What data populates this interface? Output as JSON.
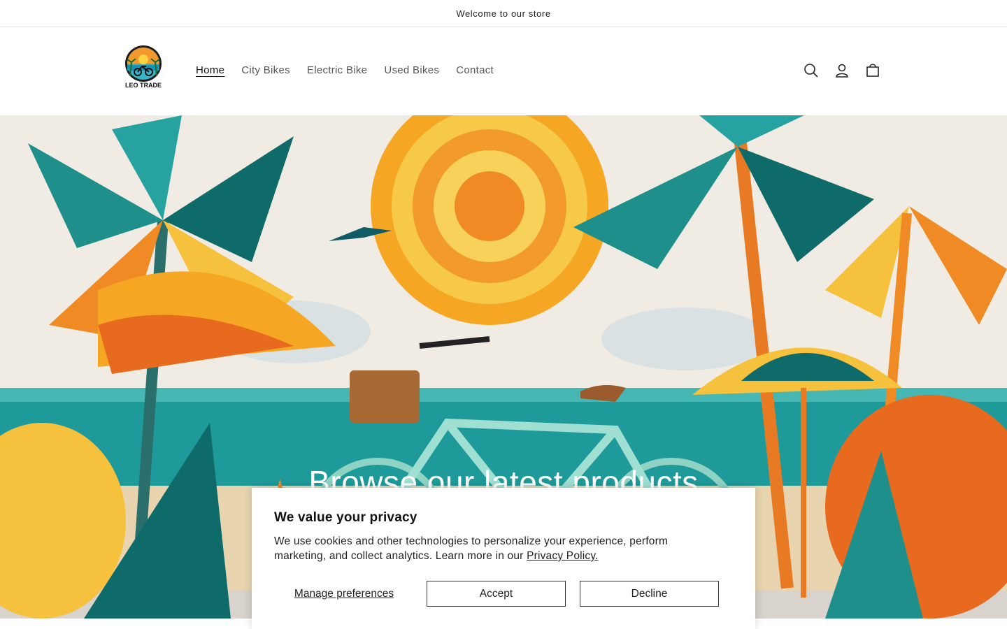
{
  "announcement": {
    "text": "Welcome to our store"
  },
  "header": {
    "logo_text": "LEO TRADE",
    "nav": [
      {
        "label": "Home",
        "active": true
      },
      {
        "label": "City Bikes"
      },
      {
        "label": "Electric Bike"
      },
      {
        "label": "Used Bikes"
      },
      {
        "label": "Contact"
      }
    ],
    "icons": [
      "search-icon",
      "account-icon",
      "cart-icon"
    ]
  },
  "hero": {
    "title": "Browse our latest products",
    "colors": {
      "teal": "#1f9a9a",
      "orange": "#f08a24",
      "yellow": "#f6c23e",
      "sky": "#f2efe8"
    }
  },
  "cookie_banner": {
    "title": "We value your privacy",
    "body": "We use cookies and other technologies to personalize your experience, perform marketing, and collect analytics. Learn more in our",
    "link_text": "Privacy Policy.",
    "manage_label": "Manage preferences",
    "accept_label": "Accept",
    "decline_label": "Decline"
  }
}
